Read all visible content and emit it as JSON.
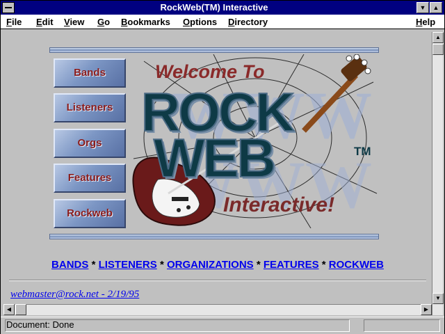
{
  "window": {
    "title": "RockWeb(TM) Interactive"
  },
  "menu": [
    "File",
    "Edit",
    "View",
    "Go",
    "Bookmarks",
    "Options",
    "Directory",
    "Help"
  ],
  "banner": {
    "nav_buttons": [
      "Bands",
      "Listeners",
      "Orgs",
      "Features",
      "Rockweb"
    ],
    "logo": {
      "welcome": "Welcome To",
      "rock": "ROCK",
      "web": "WEB",
      "tm": "TM",
      "interactive": "Interactive!"
    }
  },
  "links": {
    "items": [
      "BANDS",
      "LISTENERS",
      "ORGANIZATIONS",
      "FEATURES",
      "ROCKWEB"
    ],
    "separator": "*"
  },
  "footer": {
    "webmaster": "webmaster@rock.net - 2/19/95"
  },
  "status": {
    "text": "Document: Done"
  },
  "colors": {
    "title_bar": "#000080",
    "link": "#0000ee",
    "nav_text": "#8a1c1c",
    "logo_text": "#0e3a46"
  }
}
